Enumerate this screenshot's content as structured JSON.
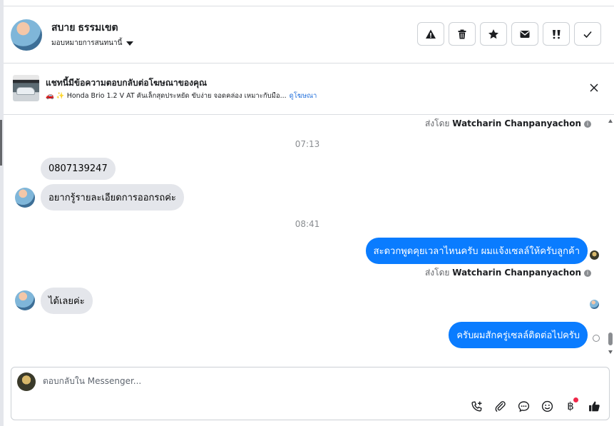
{
  "header": {
    "contact_name": "สบาย ธรรมเขต",
    "assign_label": "มอบหมายการสนทนานี้",
    "actions": [
      {
        "name": "spam-button",
        "icon": "warning-icon"
      },
      {
        "name": "delete-button",
        "icon": "trash-icon"
      },
      {
        "name": "star-button",
        "icon": "star-icon"
      },
      {
        "name": "mark-unread-button",
        "icon": "envelope-icon"
      },
      {
        "name": "follow-up-button",
        "icon": "follow-up-icon"
      },
      {
        "name": "mark-done-button",
        "icon": "check-icon"
      }
    ]
  },
  "ad_banner": {
    "title": "แชทนี้มีข้อความตอบกลับต่อโฆษณาของคุณ",
    "ad_text": "🚗 ✨ Honda Brio 1.2 V AT คันเล็กสุดประหยัด ขับง่าย จอดคล่อง เหมาะกับมือ...",
    "view_ad_link": "ดูโฆษณา"
  },
  "messages": {
    "sent_by_top": {
      "prefix": "ส่งโดย",
      "name": "Watcharin Chanpanyachon"
    },
    "time_1": "07:13",
    "in_1": "0807139247",
    "in_2": "อยากรู้รายละเอียดการออกรถค่ะ",
    "time_2": "08:41",
    "out_1": "สะดวกพูดคุยเวลาไหนครับ ผมแจ้งเซลล์ให้ครับลูกค้า",
    "sent_by_1": {
      "prefix": "ส่งโดย",
      "name": "Watcharin Chanpanyachon"
    },
    "in_3": "ได้เลยค่ะ",
    "out_2": "ครับผมสักครู่เซลล์ติดต่อไปครับ"
  },
  "composer": {
    "placeholder": "ตอบกลับใน Messenger...",
    "tools": [
      "call-icon",
      "paperclip-icon",
      "chat-bubble-icon",
      "emoji-icon",
      "baht-icon",
      "thumbs-up-icon"
    ],
    "baht_symbol": "฿"
  },
  "colors": {
    "outgoing_bubble": "#0a7cff",
    "incoming_bubble": "#e4e6eb",
    "link": "#216fdb",
    "notification_dot": "#f02849"
  }
}
